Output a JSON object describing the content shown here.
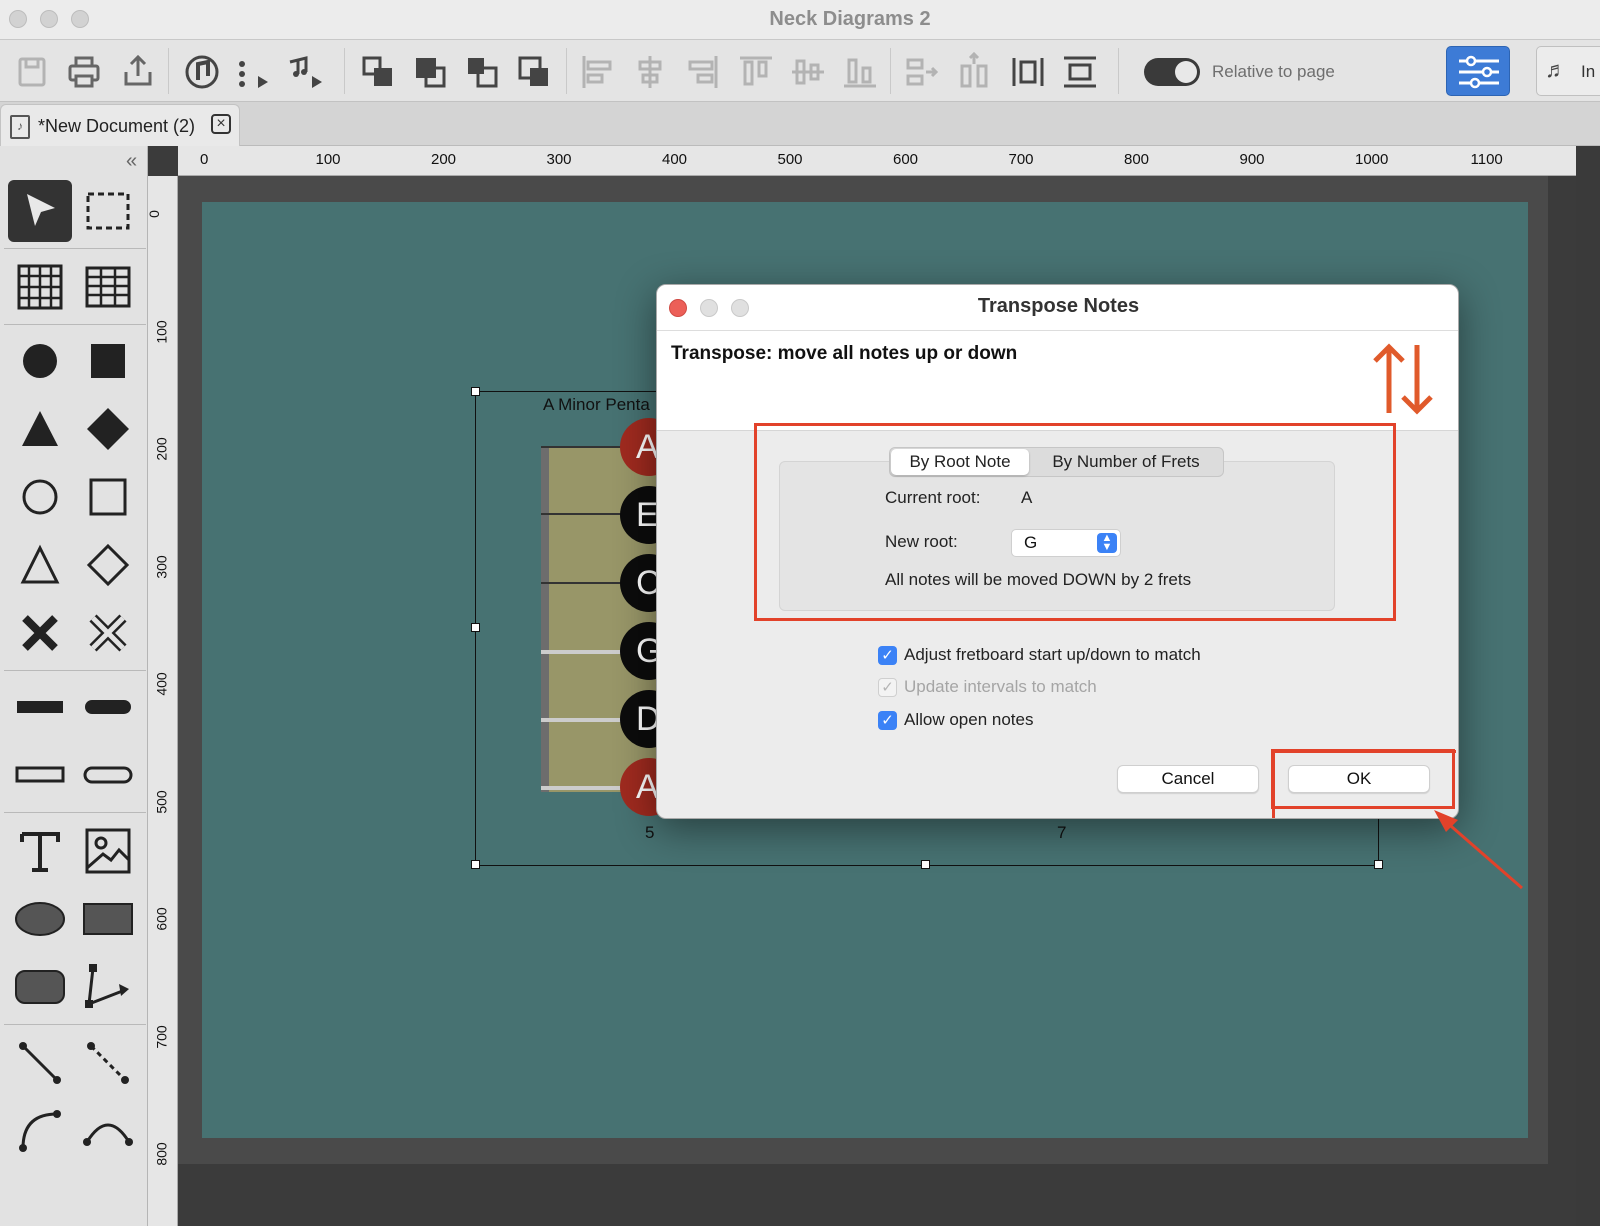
{
  "app": {
    "title": "Neck Diagrams 2"
  },
  "toolbar": {
    "relative_label": "Relative to page",
    "instruments_label": "In"
  },
  "document_tab": {
    "label": "*New Document (2)"
  },
  "ruler": {
    "horizontal": [
      "0",
      "100",
      "200",
      "300",
      "400",
      "500",
      "600",
      "700",
      "800",
      "900",
      "1000",
      "1100"
    ],
    "vertical": [
      "0",
      "100",
      "200",
      "300",
      "400",
      "500",
      "600",
      "700",
      "800"
    ]
  },
  "diagram": {
    "title": "A Minor Penta",
    "notes": [
      "A",
      "E",
      "C",
      "G",
      "D",
      "A"
    ],
    "fret_labels": [
      "5",
      "7"
    ]
  },
  "dialog": {
    "title": "Transpose Notes",
    "heading": "Transpose: move all notes up or down",
    "tabs": [
      "By Root Note",
      "By Number of Frets"
    ],
    "current_root_label": "Current root:",
    "current_root_value": "A",
    "new_root_label": "New root:",
    "new_root_value": "G",
    "summary": "All notes will be moved DOWN by 2 frets",
    "options": [
      {
        "label": "Adjust fretboard start up/down to match",
        "checked": true,
        "enabled": true
      },
      {
        "label": "Update intervals to match",
        "checked": true,
        "enabled": false
      },
      {
        "label": "Allow open notes",
        "checked": true,
        "enabled": true
      }
    ],
    "cancel_label": "Cancel",
    "ok_label": "OK"
  },
  "colors": {
    "accent_blue": "#3b82f6",
    "highlight_red": "#e2422a",
    "page_bg": "#477272",
    "note_red": "#9f2a1f",
    "note_black": "#0c0c0c"
  },
  "icons": {
    "toolbar": [
      "save-icon",
      "print-icon",
      "export-icon",
      "note-tool-icon",
      "scale-icon",
      "chord-icon",
      "bring-forward-icon",
      "bring-front-icon",
      "send-backward-icon",
      "send-back-icon",
      "align-left-icon",
      "align-center-icon",
      "align-right-icon",
      "align-top-icon",
      "align-middle-icon",
      "align-bottom-icon",
      "distribute-h-icon",
      "distribute-v-icon",
      "fit-width-icon",
      "fit-height-icon",
      "inspector-icon",
      "instruments-icon"
    ]
  }
}
